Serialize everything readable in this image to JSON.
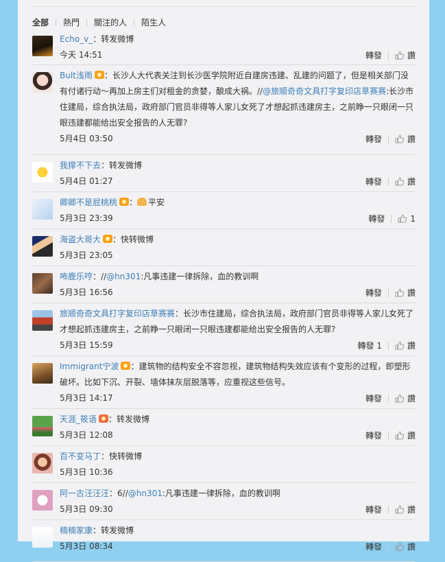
{
  "tabs": [
    "全部",
    "熱門",
    "關注的人",
    "陌生人"
  ],
  "repost_label": "轉發",
  "like_label": "讚",
  "comments": [
    {
      "user": "Echo_v_",
      "badge": "",
      "sep": "：",
      "segments": [
        {
          "t": "转发微博"
        }
      ],
      "time": "今天 14:51",
      "repost": "轉發",
      "like": "讚"
    },
    {
      "user": "Bult浅雨",
      "badge": "orange",
      "sep": "：",
      "segments": [
        {
          "t": "长沙人大代表关注到长沙医学院附近自建房违建、乱建的问题了，但是相关部门没有付诸行动～再加上房主们对租金的贪婪，酿成大祸。//"
        },
        {
          "t": "@旅顺奇奇文具打字复印店草赛赛",
          "link": true
        },
        {
          "t": ":长沙市住建局，综合执法局，政府部门官员非得等人家儿女死了才想起抓违建房主，之前睁一只眼闭一只眼违建都能给出安全报告的人无罪?"
        }
      ],
      "time": "5月4日 03:50",
      "repost": "轉發",
      "like": "讚"
    },
    {
      "user": "我撑不下去",
      "badge": "",
      "sep": "：",
      "segments": [
        {
          "t": "转发微博"
        }
      ],
      "time": "5月4日 01:27",
      "repost": "轉發",
      "like": "讚"
    },
    {
      "user": "卿卿不是屁桃桃",
      "badge": "orange",
      "sep": "：",
      "segments": [
        {
          "t": "平安",
          "pray": true
        }
      ],
      "time": "5月3日 23:39",
      "repost": "轉發",
      "like": "1"
    },
    {
      "user": "海盗大哥大",
      "badge": "orange",
      "sep": "：",
      "segments": [
        {
          "t": "快转微博"
        }
      ],
      "time": "5月3日 23:05",
      "repost": "",
      "like": ""
    },
    {
      "user": "咘鹿乐哼",
      "badge": "",
      "sep": "：",
      "segments": [
        {
          "t": "//"
        },
        {
          "t": "@hn301",
          "link": true
        },
        {
          "t": ":凡事违建一律拆除，血的教训啊"
        }
      ],
      "time": "5月3日 16:56",
      "repost": "轉發",
      "like": "讚"
    },
    {
      "user": "旅顺奇奇文具打字复印店草赛赛",
      "badge": "",
      "sep": "：",
      "segments": [
        {
          "t": "长沙市住建局，综合执法局，政府部门官员非得等人家儿女死了才想起抓违建房主，之前睁一只眼闭一只眼违建都能给出安全报告的人无罪?"
        }
      ],
      "time": "5月3日 15:59",
      "repost": "轉發 1",
      "like": "讚"
    },
    {
      "user": "Immigrant宁波",
      "badge": "orange",
      "sep": "：",
      "segments": [
        {
          "t": "建筑物的结构安全不容忽视，建筑物结构失效应该有个变形的过程，即塑形破坏。比如下沉、开裂、墙体抹灰层脱落等，应重视这些信号。"
        }
      ],
      "time": "5月3日 14:17",
      "repost": "轉發",
      "like": "讚"
    },
    {
      "user": "天涯_筱语",
      "badge": "red",
      "sep": "：",
      "segments": [
        {
          "t": "转发微博"
        }
      ],
      "time": "5月3日 12:08",
      "repost": "轉發",
      "like": "讚"
    },
    {
      "user": "百不变马丁",
      "badge": "",
      "sep": "：",
      "segments": [
        {
          "t": "快转微博"
        }
      ],
      "time": "5月3日 10:36",
      "repost": "",
      "like": ""
    },
    {
      "user": "阿一古汪汪汪",
      "badge": "",
      "sep": "：",
      "segments": [
        {
          "t": "6//"
        },
        {
          "t": "@hn301",
          "link": true
        },
        {
          "t": ":凡事违建一律拆除，血的教训啊"
        }
      ],
      "time": "5月3日 09:30",
      "repost": "轉發",
      "like": "讚"
    },
    {
      "user": "楠楠家康",
      "badge": "",
      "sep": "：",
      "segments": [
        {
          "t": "转发微博"
        }
      ],
      "time": "5月3日 08:34",
      "repost": "轉發",
      "like": "讚"
    }
  ]
}
